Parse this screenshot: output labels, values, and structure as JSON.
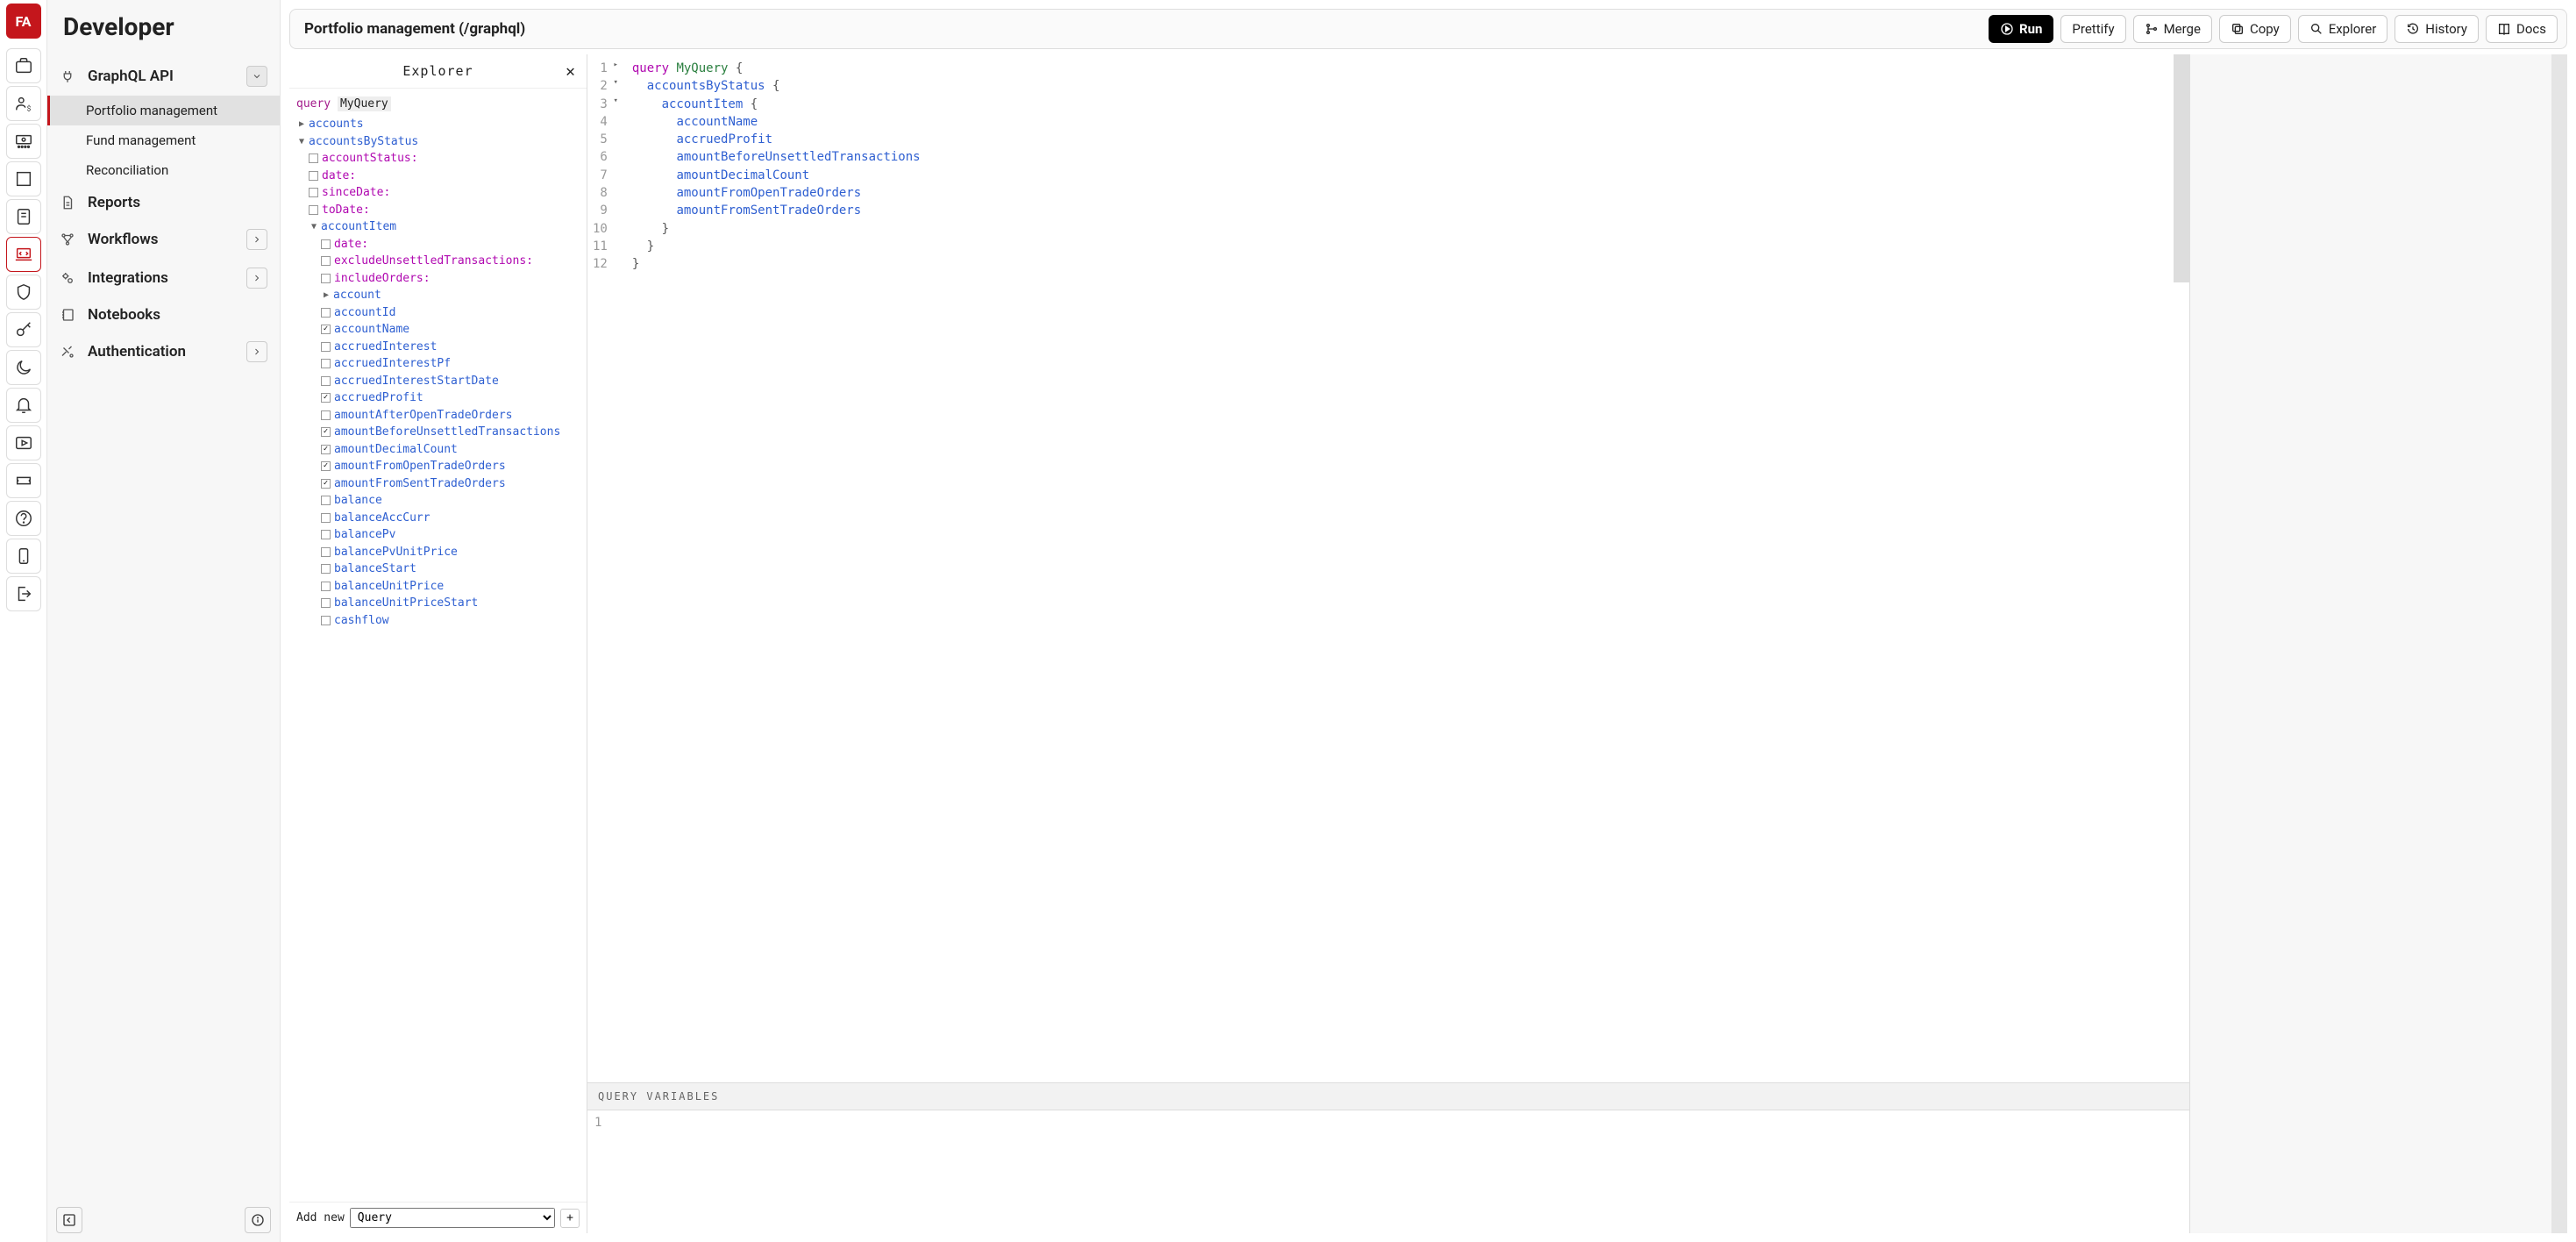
{
  "app_title": "Developer",
  "logo_text": "FA",
  "rail_icons": [
    {
      "name": "briefcase-icon"
    },
    {
      "name": "user-money-icon"
    },
    {
      "name": "banknote-grid-icon"
    },
    {
      "name": "building-icon"
    },
    {
      "name": "report-icon"
    },
    {
      "name": "code-laptop-icon",
      "active": true
    },
    {
      "name": "shield-icon"
    },
    {
      "name": "key-icon"
    },
    {
      "name": "moon-icon"
    },
    {
      "name": "bell-icon"
    },
    {
      "name": "play-icon"
    },
    {
      "name": "ticket-icon"
    },
    {
      "name": "help-icon"
    },
    {
      "name": "device-icon"
    },
    {
      "name": "logout-icon"
    }
  ],
  "sidebar": {
    "groups": [
      {
        "icon": "plug-icon",
        "label": "GraphQL API",
        "open": true,
        "items": [
          {
            "label": "Portfolio management",
            "active": true
          },
          {
            "label": "Fund management"
          },
          {
            "label": "Reconciliation"
          }
        ]
      },
      {
        "icon": "document-icon",
        "label": "Reports"
      },
      {
        "icon": "workflow-icon",
        "label": "Workflows",
        "chev": true
      },
      {
        "icon": "gears-icon",
        "label": "Integrations",
        "chev": true
      },
      {
        "icon": "notebook-icon",
        "label": "Notebooks"
      },
      {
        "icon": "tools-icon",
        "label": "Authentication",
        "chev": true
      }
    ]
  },
  "toolbar": {
    "title": "Portfolio management (/graphql)",
    "run": "Run",
    "prettify": "Prettify",
    "merge": "Merge",
    "copy": "Copy",
    "explorer": "Explorer",
    "history": "History",
    "docs": "Docs"
  },
  "explorer": {
    "title": "Explorer",
    "root_keyword": "query",
    "root_name": "MyQuery",
    "tree": [
      {
        "indent": 0,
        "twist": "▶",
        "label": "accounts",
        "color": "blue"
      },
      {
        "indent": 0,
        "twist": "▼",
        "label": "accountsByStatus",
        "color": "blue"
      },
      {
        "indent": 1,
        "checkbox": false,
        "label": "accountStatus:",
        "color": "purple"
      },
      {
        "indent": 1,
        "checkbox": false,
        "label": "date:",
        "color": "purple"
      },
      {
        "indent": 1,
        "checkbox": false,
        "label": "sinceDate:",
        "color": "purple"
      },
      {
        "indent": 1,
        "checkbox": false,
        "label": "toDate:",
        "color": "purple"
      },
      {
        "indent": 1,
        "twist": "▼",
        "label": "accountItem",
        "color": "blue"
      },
      {
        "indent": 2,
        "checkbox": false,
        "label": "date:",
        "color": "purple"
      },
      {
        "indent": 2,
        "checkbox": false,
        "label": "excludeUnsettledTransactions:",
        "color": "purple"
      },
      {
        "indent": 2,
        "checkbox": false,
        "label": "includeOrders:",
        "color": "purple"
      },
      {
        "indent": 2,
        "twist": "▶",
        "label": "account",
        "color": "blue"
      },
      {
        "indent": 2,
        "checkbox": false,
        "label": "accountId",
        "color": "blue"
      },
      {
        "indent": 2,
        "checkbox": true,
        "label": "accountName",
        "color": "blue"
      },
      {
        "indent": 2,
        "checkbox": false,
        "label": "accruedInterest",
        "color": "blue"
      },
      {
        "indent": 2,
        "checkbox": false,
        "label": "accruedInterestPf",
        "color": "blue"
      },
      {
        "indent": 2,
        "checkbox": false,
        "label": "accruedInterestStartDate",
        "color": "blue"
      },
      {
        "indent": 2,
        "checkbox": true,
        "label": "accruedProfit",
        "color": "blue"
      },
      {
        "indent": 2,
        "checkbox": false,
        "label": "amountAfterOpenTradeOrders",
        "color": "blue"
      },
      {
        "indent": 2,
        "checkbox": true,
        "label": "amountBeforeUnsettledTransactions",
        "color": "blue"
      },
      {
        "indent": 2,
        "checkbox": true,
        "label": "amountDecimalCount",
        "color": "blue"
      },
      {
        "indent": 2,
        "checkbox": true,
        "label": "amountFromOpenTradeOrders",
        "color": "blue"
      },
      {
        "indent": 2,
        "checkbox": true,
        "label": "amountFromSentTradeOrders",
        "color": "blue"
      },
      {
        "indent": 2,
        "checkbox": false,
        "label": "balance",
        "color": "blue"
      },
      {
        "indent": 2,
        "checkbox": false,
        "label": "balanceAccCurr",
        "color": "blue"
      },
      {
        "indent": 2,
        "checkbox": false,
        "label": "balancePv",
        "color": "blue"
      },
      {
        "indent": 2,
        "checkbox": false,
        "label": "balancePvUnitPrice",
        "color": "blue"
      },
      {
        "indent": 2,
        "checkbox": false,
        "label": "balanceStart",
        "color": "blue"
      },
      {
        "indent": 2,
        "checkbox": false,
        "label": "balanceUnitPrice",
        "color": "blue"
      },
      {
        "indent": 2,
        "checkbox": false,
        "label": "balanceUnitPriceStart",
        "color": "blue"
      },
      {
        "indent": 2,
        "checkbox": false,
        "label": "cashflow",
        "color": "blue"
      }
    ],
    "footer_label": "Add new",
    "footer_select": "Query",
    "footer_plus": "+"
  },
  "editor": {
    "lines": [
      {
        "n": 1,
        "fold": "▸",
        "tokens": [
          [
            "kw",
            "query"
          ],
          [
            "sp",
            " "
          ],
          [
            "name",
            "MyQuery"
          ],
          [
            "sp",
            " "
          ],
          [
            "brace",
            "{"
          ]
        ]
      },
      {
        "n": 2,
        "fold": "▾",
        "tokens": [
          [
            "sp",
            "  "
          ],
          [
            "field",
            "accountsByStatus"
          ],
          [
            "sp",
            " "
          ],
          [
            "brace",
            "{"
          ]
        ]
      },
      {
        "n": 3,
        "fold": "▾",
        "tokens": [
          [
            "sp",
            "    "
          ],
          [
            "field",
            "accountItem"
          ],
          [
            "sp",
            " "
          ],
          [
            "brace",
            "{"
          ]
        ]
      },
      {
        "n": 4,
        "tokens": [
          [
            "sp",
            "      "
          ],
          [
            "field",
            "accountName"
          ]
        ]
      },
      {
        "n": 5,
        "tokens": [
          [
            "sp",
            "      "
          ],
          [
            "field",
            "accruedProfit"
          ]
        ]
      },
      {
        "n": 6,
        "tokens": [
          [
            "sp",
            "      "
          ],
          [
            "field",
            "amountBeforeUnsettledTransactions"
          ]
        ]
      },
      {
        "n": 7,
        "tokens": [
          [
            "sp",
            "      "
          ],
          [
            "field",
            "amountDecimalCount"
          ]
        ]
      },
      {
        "n": 8,
        "tokens": [
          [
            "sp",
            "      "
          ],
          [
            "field",
            "amountFromOpenTradeOrders"
          ]
        ]
      },
      {
        "n": 9,
        "tokens": [
          [
            "sp",
            "      "
          ],
          [
            "field",
            "amountFromSentTradeOrders"
          ]
        ]
      },
      {
        "n": 10,
        "tokens": [
          [
            "sp",
            "    "
          ],
          [
            "brace",
            "}"
          ]
        ]
      },
      {
        "n": 11,
        "tokens": [
          [
            "sp",
            "  "
          ],
          [
            "brace",
            "}"
          ]
        ]
      },
      {
        "n": 12,
        "tokens": [
          [
            "brace",
            "}"
          ]
        ]
      }
    ],
    "qvars_title": "QUERY VARIABLES",
    "qvars_line": "1"
  }
}
